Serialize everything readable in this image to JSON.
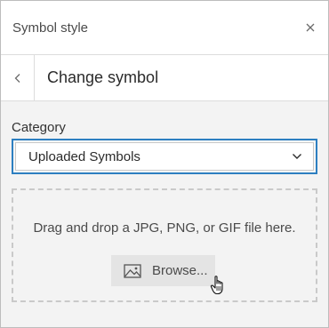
{
  "panel": {
    "title": "Symbol style",
    "close_icon": "close-icon"
  },
  "subheader": {
    "title": "Change symbol",
    "back_icon": "chevron-left-icon"
  },
  "category": {
    "label": "Category",
    "selected": "Uploaded Symbols",
    "dropdown_icon": "chevron-down-icon"
  },
  "dropzone": {
    "instructions": "Drag and drop a JPG, PNG, or GIF file here.",
    "browse_label": "Browse...",
    "browse_icon": "image-icon"
  },
  "colors": {
    "focus_border": "#2d7fc1",
    "panel_background": "#f3f3f3",
    "button_background": "#e4e4e4"
  }
}
